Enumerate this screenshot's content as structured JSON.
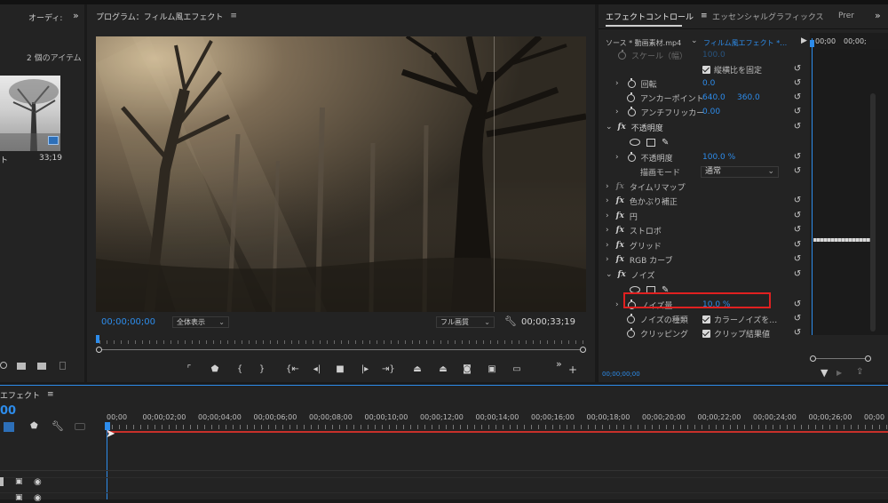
{
  "project": {
    "tab_label": "オーディ:",
    "items_count": "2 個のアイテム",
    "clip_name": "ト",
    "clip_duration": "33;19"
  },
  "program": {
    "title": "プログラム：フィルム風エフェクト",
    "current_time": "00;00;00;00",
    "zoom": "全体表示",
    "quality": "フル画質",
    "duration": "00;00;33;19"
  },
  "effect_controls": {
    "tab_active": "エフェクトコントロール",
    "tab_essential": "エッセンシャルグラフィックス",
    "tab_pre": "Prer",
    "source": "ソース * 動画素材.mp4",
    "sequence": "フィルム風エフェクト *…",
    "ruler_start": "00;00",
    "ruler_next": "00;00;",
    "footer_time": "00;00;00;00",
    "rows": {
      "scale_label": "スケール（幅）",
      "scale_value": "100.0",
      "uniform_scale": "縦横比を固定",
      "rotation_label": "回転",
      "rotation_value": "0.0",
      "anchor_label": "アンカーポイント",
      "anchor_x": "640.0",
      "anchor_y": "360.0",
      "antiflicker_label": "アンチフリッカー",
      "antiflicker_value": "0.00",
      "opacity_group": "不透明度",
      "opacity_label": "不透明度",
      "opacity_value": "100.0 %",
      "blend_label": "描画モード",
      "blend_value": "通常",
      "time_remap": "タイムリマップ",
      "color_balance": "色かぶり補正",
      "circle": "円",
      "strobe": "ストロボ",
      "grid": "グリッド",
      "rgb_curves": "RGB カーブ",
      "noise_group": "ノイズ",
      "noise_amount_label": "ノイズ量",
      "noise_amount_value": "10.0 %",
      "noise_type_label": "ノイズの種類",
      "noise_type_value": "カラーノイズを…",
      "clipping_label": "クリッピング",
      "clipping_value": "クリップ結果値"
    }
  },
  "timeline": {
    "title": "エフェクト",
    "current_time": "00",
    "ruler": [
      "00;00",
      "00;00;02;00",
      "00;00;04;00",
      "00;00;06;00",
      "00;00;08;00",
      "00;00;10;00",
      "00;00;12;00",
      "00;00;14;00",
      "00;00;16;00",
      "00;00;18;00",
      "00;00;20;00",
      "00;00;22;00",
      "00;00;24;00",
      "00;00;26;00",
      "00;00"
    ]
  },
  "colors": {
    "accent": "#2d8ceb",
    "highlight_box": "#e02020",
    "work_area": "#c8302a"
  }
}
